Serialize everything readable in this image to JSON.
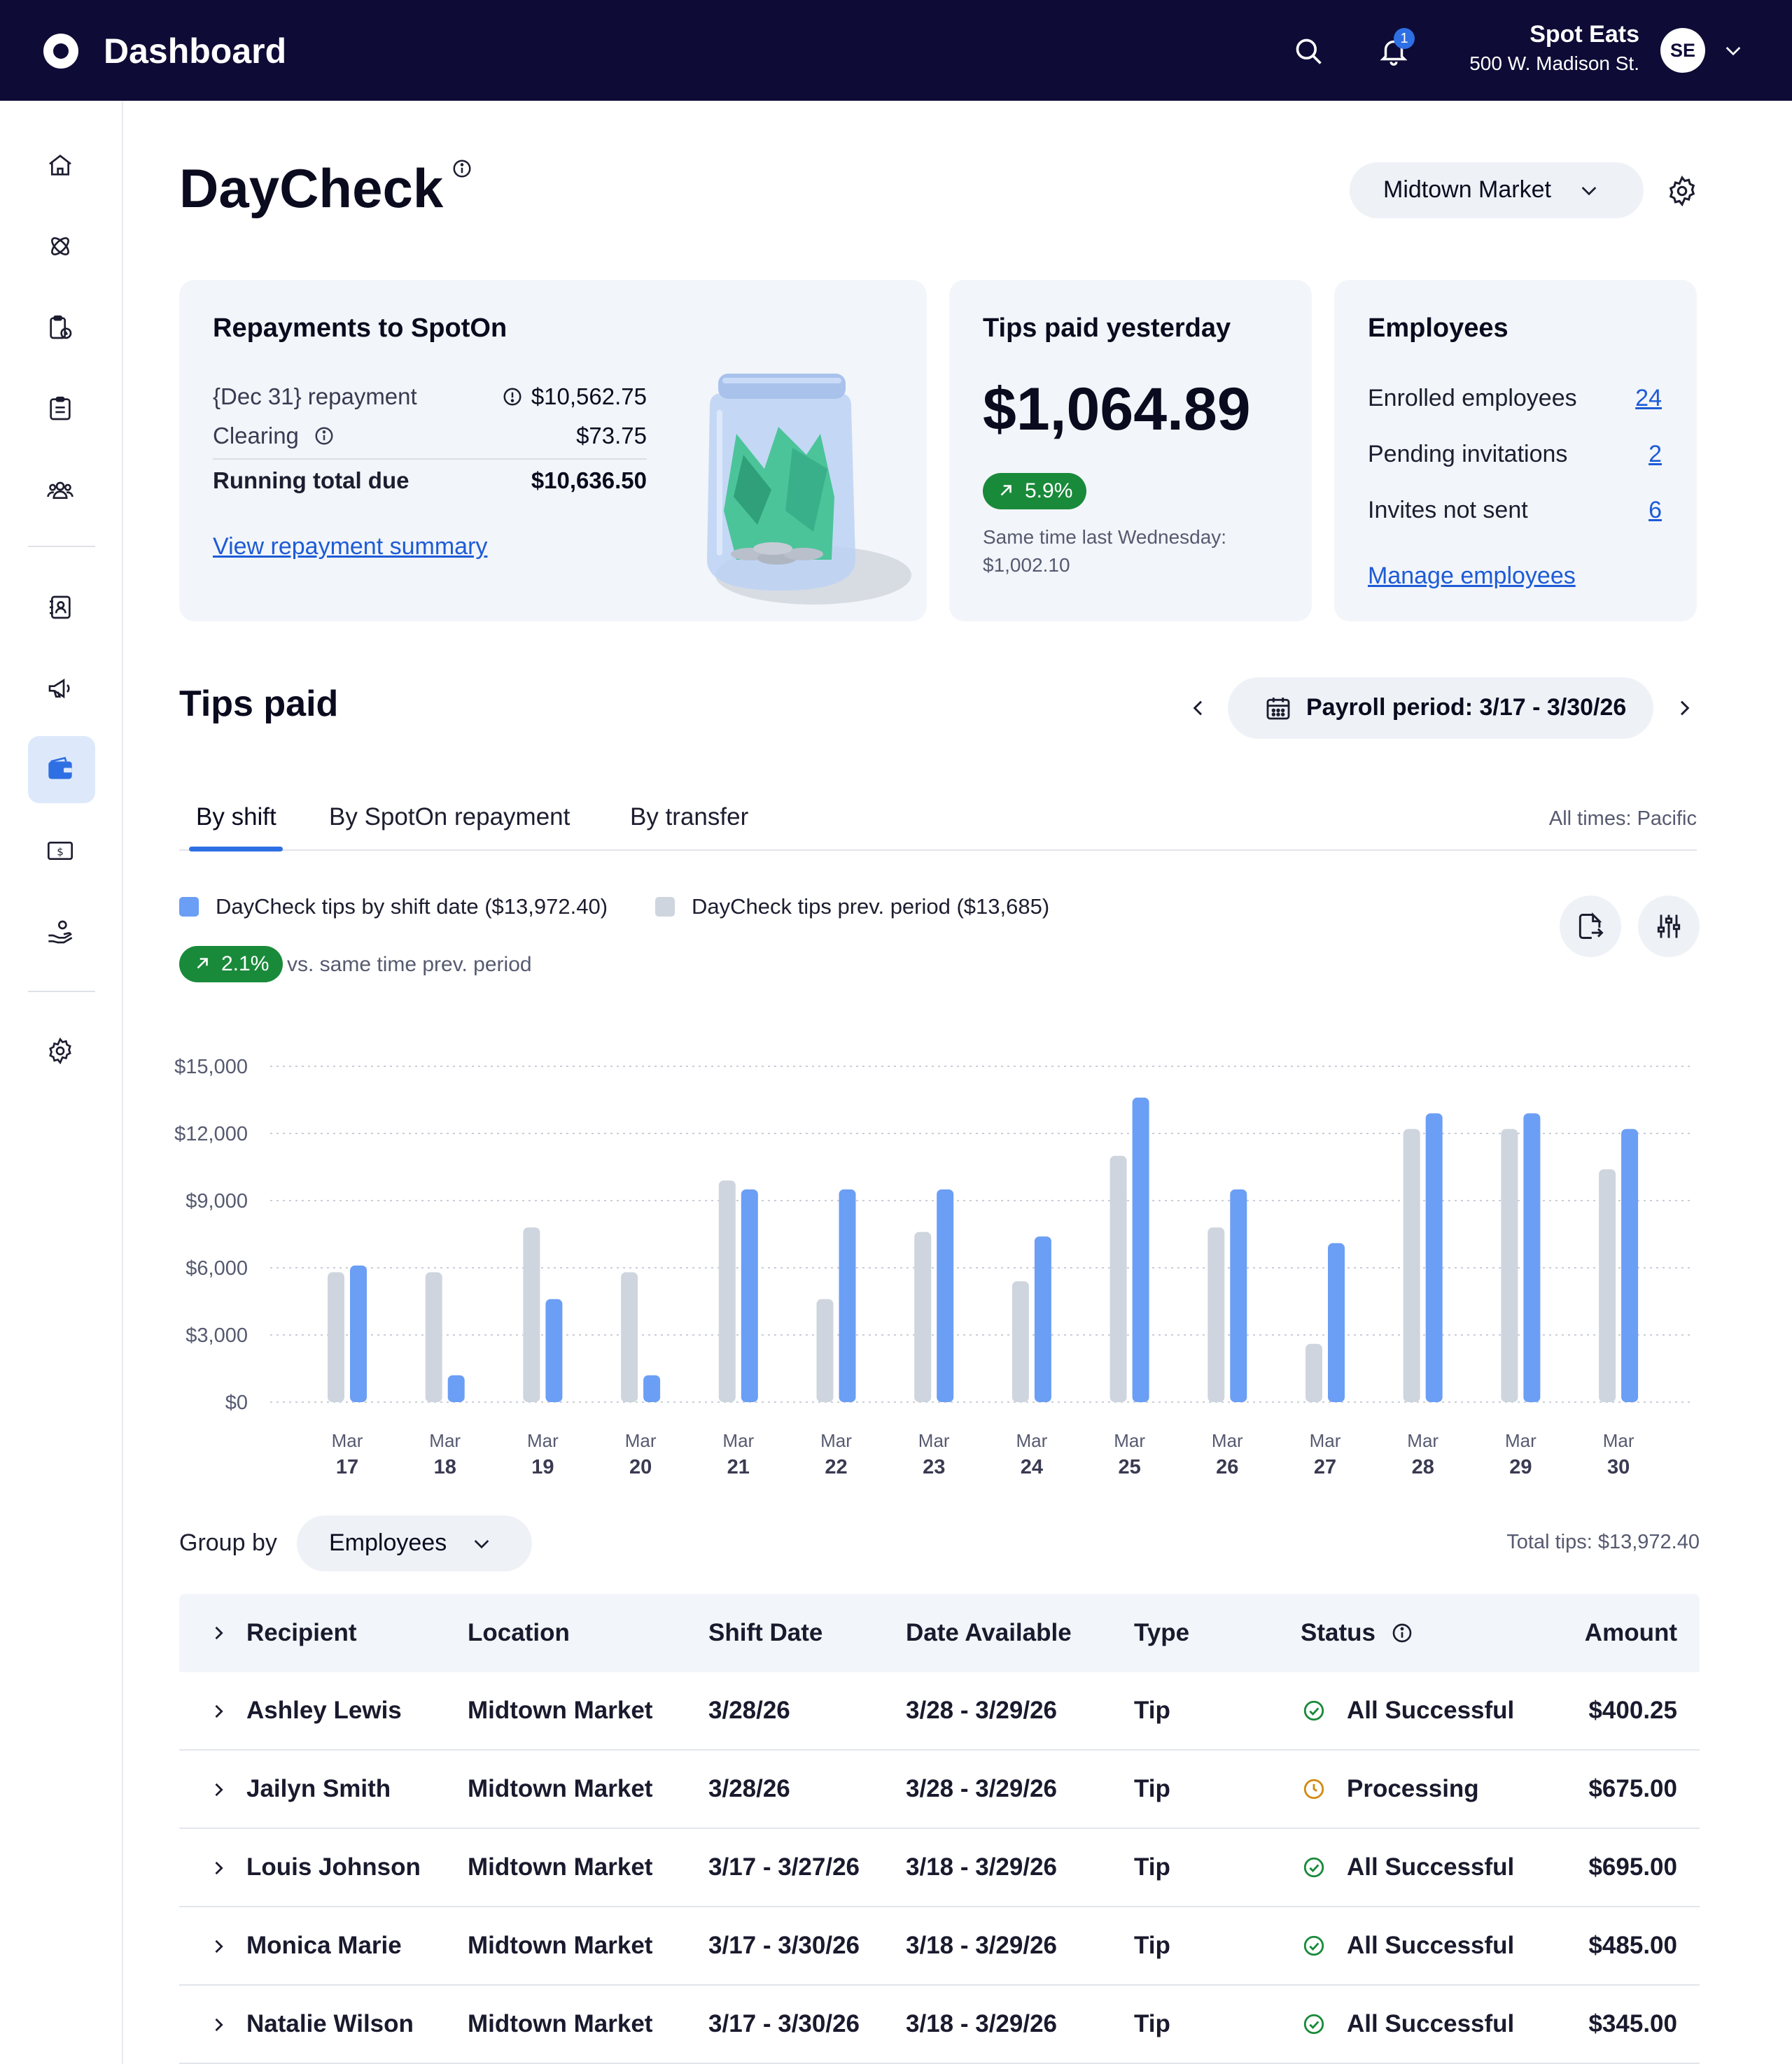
{
  "app": {
    "title": "Dashboard"
  },
  "topbar": {
    "notifications_count": "1",
    "org_name": "Spot Eats",
    "org_address": "500 W. Madison St.",
    "avatar_initials": "SE"
  },
  "sidebar": {
    "items": [
      {
        "icon": "home-icon"
      },
      {
        "icon": "integrations-icon"
      },
      {
        "icon": "clipboard-clock-icon"
      },
      {
        "icon": "report-icon"
      },
      {
        "icon": "team-icon"
      },
      {
        "icon": "contacts-icon"
      },
      {
        "icon": "megaphone-icon"
      },
      {
        "icon": "wallet-icon",
        "active": true
      },
      {
        "icon": "cash-icon"
      },
      {
        "icon": "hand-user-icon"
      },
      {
        "icon": "settings-icon"
      }
    ]
  },
  "header": {
    "title": "DayCheck",
    "location": "Midtown Market"
  },
  "repayments": {
    "title": "Repayments to SpotOn",
    "repayment_label": "{Dec 31} repayment",
    "repayment_value": "$10,562.75",
    "clearing_label": "Clearing",
    "clearing_value": "$73.75",
    "total_label": "Running total due",
    "total_value": "$10,636.50",
    "link": "View repayment summary"
  },
  "tips_yesterday": {
    "title": "Tips paid yesterday",
    "amount": "$1,064.89",
    "change": "5.9%",
    "compare_label": "Same time last Wednesday:",
    "compare_value": "$1,002.10"
  },
  "employees": {
    "title": "Employees",
    "rows": [
      {
        "label": "Enrolled employees",
        "value": "24"
      },
      {
        "label": "Pending invitations",
        "value": "2"
      },
      {
        "label": "Invites not sent",
        "value": "6"
      }
    ],
    "link": "Manage employees"
  },
  "tips_paid": {
    "title": "Tips paid",
    "period": "Payroll period: 3/17 - 3/30/26",
    "tabs": [
      "By shift",
      "By SpotOn repayment",
      "By transfer"
    ],
    "active_tab": 0,
    "timezone": "All times: Pacific",
    "legend_current": "DayCheck tips by shift date ($13,972.40)",
    "legend_prev": "DayCheck tips prev. period ($13,685)",
    "change": "2.1%",
    "vs_text": "vs. same time prev. period",
    "colors": {
      "current": "#6b9ef5",
      "previous": "#cfd5de",
      "positive": "#198a3a"
    }
  },
  "chart_data": {
    "type": "bar",
    "categories": [
      "Mar 17",
      "Mar 18",
      "Mar 19",
      "Mar 20",
      "Mar 21",
      "Mar 22",
      "Mar 23",
      "Mar 24",
      "Mar 25",
      "Mar 26",
      "Mar 27",
      "Mar 28",
      "Mar 29",
      "Mar 30"
    ],
    "category_month": "Mar",
    "category_days": [
      "17",
      "18",
      "19",
      "20",
      "21",
      "22",
      "23",
      "24",
      "25",
      "26",
      "27",
      "28",
      "29",
      "30"
    ],
    "series": [
      {
        "name": "DayCheck tips prev. period ($13,685)",
        "values": [
          5800,
          5800,
          7800,
          5800,
          9900,
          4600,
          7600,
          5400,
          11000,
          7800,
          2600,
          12200,
          12200,
          10400
        ]
      },
      {
        "name": "DayCheck tips by shift date ($13,972.40)",
        "values": [
          6100,
          1200,
          4600,
          1200,
          9500,
          9500,
          9500,
          7400,
          13600,
          9500,
          7100,
          12900,
          12900,
          12200
        ]
      }
    ],
    "yticks": [
      "$0",
      "$3,000",
      "$6,000",
      "$9,000",
      "$12,000",
      "$15,000"
    ],
    "ylim": [
      0,
      15000
    ],
    "grid": true
  },
  "table": {
    "group_by_label": "Group by",
    "group_by_value": "Employees",
    "total": "Total tips: $13,972.40",
    "headers": [
      "Recipient",
      "Location",
      "Shift Date",
      "Date Available",
      "Type",
      "Status",
      "Amount"
    ],
    "rows": [
      {
        "recipient": "Ashley Lewis",
        "location": "Midtown Market",
        "shift": "3/28/26",
        "available": "3/28 - 3/29/26",
        "type": "Tip",
        "status": "All Successful",
        "status_kind": "success",
        "amount": "$400.25"
      },
      {
        "recipient": "Jailyn Smith",
        "location": "Midtown Market",
        "shift": "3/28/26",
        "available": "3/28 - 3/29/26",
        "type": "Tip",
        "status": "Processing",
        "status_kind": "processing",
        "amount": "$675.00"
      },
      {
        "recipient": "Louis Johnson",
        "location": "Midtown Market",
        "shift": "3/17 - 3/27/26",
        "available": "3/18 - 3/29/26",
        "type": "Tip",
        "status": "All Successful",
        "status_kind": "success",
        "amount": "$695.00"
      },
      {
        "recipient": "Monica Marie",
        "location": "Midtown Market",
        "shift": "3/17 - 3/30/26",
        "available": "3/18 - 3/29/26",
        "type": "Tip",
        "status": "All Successful",
        "status_kind": "success",
        "amount": "$485.00"
      },
      {
        "recipient": "Natalie Wilson",
        "location": "Midtown Market",
        "shift": "3/17 - 3/30/26",
        "available": "3/18 - 3/29/26",
        "type": "Tip",
        "status": "All Successful",
        "status_kind": "success",
        "amount": "$345.00"
      }
    ]
  }
}
